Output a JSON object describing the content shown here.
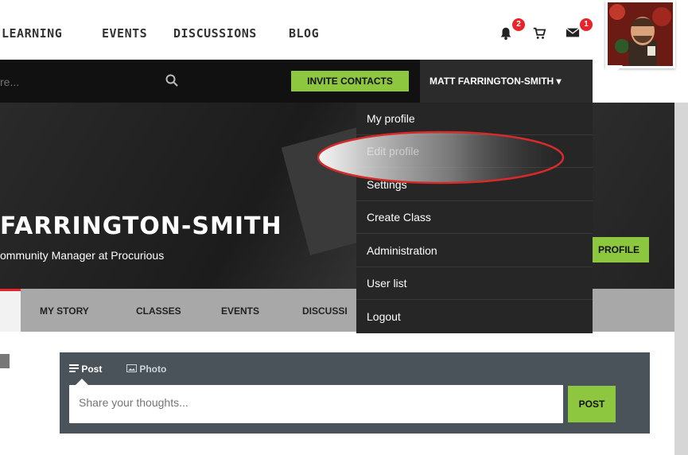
{
  "topnav": {
    "links": [
      "LEARNING",
      "EVENTS",
      "DISCUSSIONS",
      "BLOG"
    ],
    "notifications_count": "2",
    "messages_count": "1"
  },
  "searchbar": {
    "placeholder": "re...",
    "invite_label": "INVITE CONTACTS",
    "user_name": "MATT FARRINGTON-SMITH ▾"
  },
  "dropdown": {
    "items": [
      "My profile",
      "Edit profile",
      "Settings",
      "Create Class",
      "Administration",
      "User list",
      "Logout"
    ]
  },
  "hero": {
    "name": "FARRINGTON-SMITH",
    "subtitle": "ommunity Manager at Procurious",
    "profile_button": "PROFILE"
  },
  "tabs": [
    "MY STORY",
    "CLASSES",
    "EVENTS",
    "DISCUSSI"
  ],
  "post": {
    "tab_post": "Post",
    "tab_photo": "Photo",
    "placeholder": "Share your thoughts...",
    "button": "POST"
  },
  "colors": {
    "accent_green": "#8dc63f",
    "badge_red": "#e8232a",
    "dark_bar": "#111111",
    "dropdown_bg": "#262626"
  }
}
